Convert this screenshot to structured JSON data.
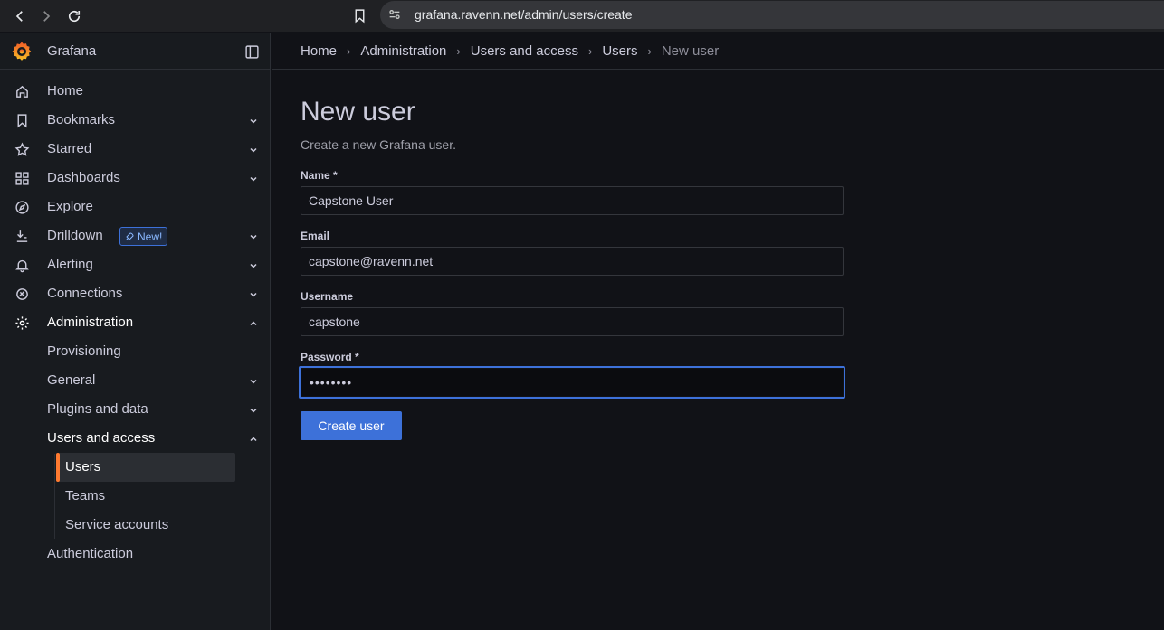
{
  "browser": {
    "url": "grafana.ravenn.net/admin/users/create"
  },
  "sidebar": {
    "brand": "Grafana",
    "items": [
      {
        "label": "Home",
        "icon": "home-icon"
      },
      {
        "label": "Bookmarks",
        "icon": "bookmark-icon",
        "expandable": true
      },
      {
        "label": "Starred",
        "icon": "star-icon",
        "expandable": true
      },
      {
        "label": "Dashboards",
        "icon": "dashboards-icon",
        "expandable": true
      },
      {
        "label": "Explore",
        "icon": "compass-icon"
      },
      {
        "label": "Drilldown",
        "icon": "drilldown-icon",
        "expandable": true,
        "badge": "New!"
      },
      {
        "label": "Alerting",
        "icon": "bell-icon",
        "expandable": true
      },
      {
        "label": "Connections",
        "icon": "connections-icon",
        "expandable": true
      },
      {
        "label": "Administration",
        "icon": "cog-icon",
        "expanded": true
      }
    ],
    "admin_children": [
      {
        "label": "Provisioning"
      },
      {
        "label": "General",
        "expandable": true
      },
      {
        "label": "Plugins and data",
        "expandable": true
      },
      {
        "label": "Users and access",
        "expanded": true
      }
    ],
    "users_access_children": [
      {
        "label": "Users",
        "active": true
      },
      {
        "label": "Teams"
      },
      {
        "label": "Service accounts"
      }
    ],
    "authentication": "Authentication"
  },
  "breadcrumb": [
    "Home",
    "Administration",
    "Users and access",
    "Users",
    "New user"
  ],
  "page": {
    "title": "New user",
    "subtitle": "Create a new Grafana user."
  },
  "form": {
    "name_label": "Name *",
    "name_value": "Capstone User",
    "email_label": "Email",
    "email_value": "capstone@ravenn.net",
    "username_label": "Username",
    "username_value": "capstone",
    "password_label": "Password *",
    "password_value": "••••••••",
    "submit_label": "Create user"
  },
  "colors": {
    "accent": "#3d71d9",
    "active_bar": "#ff7a30",
    "background": "#111217",
    "sidebar": "#181b1f"
  }
}
